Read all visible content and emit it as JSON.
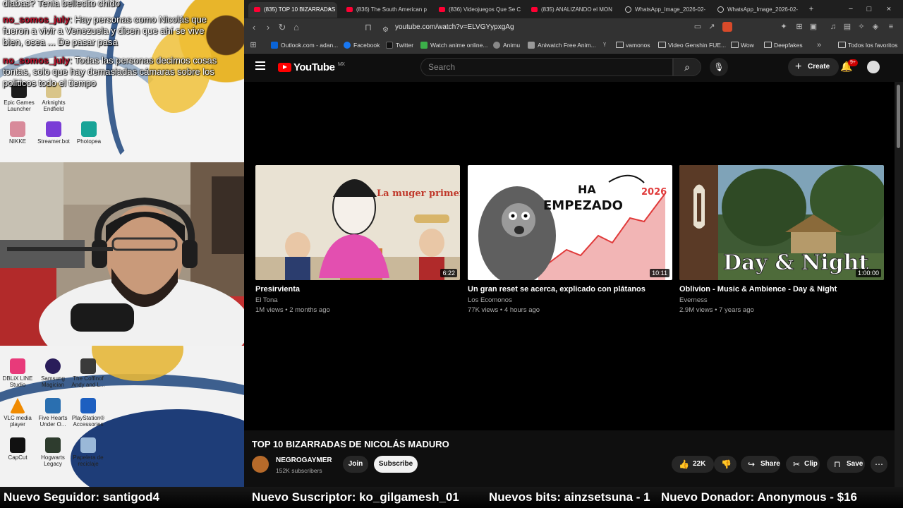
{
  "overlay": {
    "chat": [
      {
        "user": "",
        "text": "diabas? Tenia bellecito chido"
      },
      {
        "user": "no_somos_july",
        "text": "Hay personas como Nicolás que fueron a vivir a Venezuela y dicen que ahí se vive bien, osea ... De pasar pasa"
      },
      {
        "user": "no_somos_july",
        "text": "Todas las personas decimos cosas tontas, solo que hay demasiadas cámaras sobre los politicos todo el tiempo"
      }
    ],
    "desktop_icons_top": [
      {
        "label": "Epic Games Launcher",
        "icon": "epic-games-icon",
        "color": "#1c1c1c"
      },
      {
        "label": "Arknights Endfield",
        "icon": "arknights-icon",
        "color": "#d9c58a"
      },
      {
        "label": "NIKKE",
        "icon": "nikke-icon",
        "color": "#d88a9a"
      },
      {
        "label": "Streamer.bot",
        "icon": "streamerbot-icon",
        "color": "#7a3dd6"
      },
      {
        "label": "Photopea",
        "icon": "photopea-icon",
        "color": "#18a497"
      }
    ],
    "desktop_icons_bottom": [
      {
        "label": "DBLiX LINE Studio",
        "icon": "dblix-icon",
        "color": "#e83a7a"
      },
      {
        "label": "Samsung Magician",
        "icon": "samsung-magician-icon",
        "color": "#2a1d5a"
      },
      {
        "label": "The Coffinof Andy and L...",
        "icon": "coffin-icon",
        "color": "#3a3a3a"
      },
      {
        "label": "VLC media player",
        "icon": "vlc-icon",
        "color": "#f08a00"
      },
      {
        "label": "Five Hearts Under O...",
        "icon": "five-hearts-icon",
        "color": "#2a6fb0"
      },
      {
        "label": "PlayStation® Accessories",
        "icon": "playstation-icon",
        "color": "#1d5fc0"
      },
      {
        "label": "CapCut",
        "icon": "capcut-icon",
        "color": "#111111"
      },
      {
        "label": "Hogwarts Legacy",
        "icon": "hogwarts-icon",
        "color": "#2e3c2e"
      },
      {
        "label": "Papelera de reciclaje",
        "icon": "recycle-bin-icon",
        "color": "#9ab8d8"
      }
    ]
  },
  "browser": {
    "tabs": [
      {
        "label": "(835) TOP 10 BIZARRADAS",
        "icon": "youtube-icon",
        "active": true
      },
      {
        "label": "(836) The South American p",
        "icon": "youtube-icon",
        "active": false
      },
      {
        "label": "(836) Videojuegos Que Se C",
        "icon": "youtube-icon",
        "active": false
      },
      {
        "label": "(835) ANALIZANDO el MON",
        "icon": "youtube-icon",
        "active": false
      },
      {
        "label": "WhatsApp_Image_2026-02-",
        "icon": "globe-icon",
        "active": false
      },
      {
        "label": "WhatsApp_Image_2026-02-",
        "icon": "globe-icon",
        "active": false
      }
    ],
    "url": "youtube.com/watch?v=ELVGYypxgAg",
    "bookmarks": [
      {
        "label": "Outlook.com - adan...",
        "icon": "outlook-icon",
        "color": "#0a64d8"
      },
      {
        "label": "Facebook",
        "icon": "facebook-icon",
        "color": "#1877f2"
      },
      {
        "label": "Twitter",
        "icon": "x-icon",
        "color": "#111111"
      },
      {
        "label": "Watch anime online...",
        "icon": "anime-icon",
        "color": "#3cb04a"
      },
      {
        "label": "Animu",
        "icon": "animu-icon",
        "color": "#888888"
      },
      {
        "label": "Aniwatch Free Anim...",
        "icon": "aniwatch-icon",
        "color": "#999999"
      },
      {
        "label": "vamonos",
        "icon": "folder-icon",
        "color": ""
      },
      {
        "label": "Video Genshin FUE...",
        "icon": "folder-icon",
        "color": ""
      },
      {
        "label": "Wow",
        "icon": "folder-icon",
        "color": ""
      },
      {
        "label": "Deepfakes",
        "icon": "folder-icon",
        "color": ""
      }
    ],
    "all_bookmarks": "Todos los favoritos"
  },
  "youtube": {
    "logo": "YouTube",
    "region": "MX",
    "search_placeholder": "Search",
    "create_label": "Create",
    "notif_count": "9+",
    "end_cards": [
      {
        "title": "Presirvienta",
        "channel": "El Tona",
        "meta": "1M views • 2 months ago",
        "duration": "6:22",
        "thumb_text": "La muger primero"
      },
      {
        "title": "Un gran reset se acerca, explicado con plátanos",
        "channel": "Los Ecomonos",
        "meta": "77K views • 4 hours ago",
        "duration": "10:11",
        "thumb_text": "HA EMPEZADO",
        "thumb_year": "2026"
      },
      {
        "title": "Oblivion - Music & Ambience - Day & Night",
        "channel": "Everness",
        "meta": "2.9M views • 7 years ago",
        "duration": "1:00:00",
        "thumb_text": "Day & Night"
      }
    ],
    "video": {
      "title": "TOP 10 BIZARRADAS DE NICOLÁS MADURO",
      "channel": "NEGROGAYMER",
      "subscribers": "152K subscribers",
      "join": "Join",
      "subscribe": "Subscribe",
      "likes": "22K",
      "share": "Share",
      "clip": "Clip",
      "save": "Save"
    }
  },
  "ticker": {
    "follower": "Nuevo Seguidor: santigod4",
    "subscriber": "Nuevo Suscriptor: ko_gilgamesh_01",
    "bits": "Nuevos bits: ainzsetsuna - 1",
    "donor": "Nuevo Donador: Anonymous - $16"
  }
}
